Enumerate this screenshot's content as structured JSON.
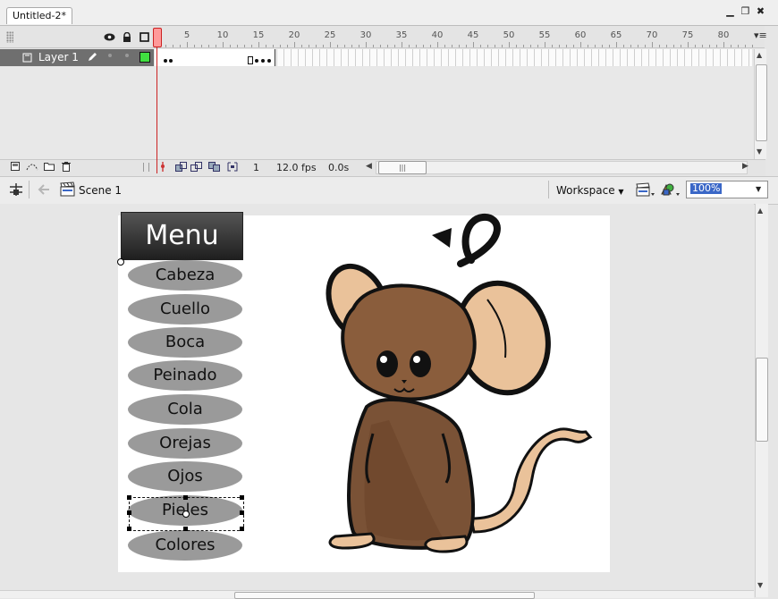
{
  "document": {
    "tab_title": "Untitled-2*"
  },
  "window_controls": {
    "minimize": "▁",
    "restore": "❐",
    "close": "✖"
  },
  "timeline": {
    "ruler_labels": [
      "5",
      "10",
      "15",
      "20",
      "25",
      "30",
      "35",
      "40",
      "45",
      "50",
      "55",
      "60",
      "65",
      "70",
      "75",
      "80"
    ],
    "layer_name": "Layer 1",
    "status": {
      "frame": "1",
      "fps": "12.0 fps",
      "time": "0.0s"
    }
  },
  "editbar": {
    "scene_label": "Scene 1",
    "workspace_label": "Workspace",
    "zoom_value": "100%"
  },
  "stage": {
    "menu_title": "Menu",
    "menu_items": [
      "Cabeza",
      "Cuello",
      "Boca",
      "Peinado",
      "Cola",
      "Orejas",
      "Ojos",
      "Pieles",
      "Colores"
    ],
    "selected_item": "Pieles"
  },
  "icons": [
    "eye-icon",
    "lock-icon",
    "outline-icon",
    "pencil-icon",
    "new-layer-icon",
    "add-guide-icon",
    "new-folder-icon",
    "delete-layer-icon",
    "center-frame-icon",
    "onion-skin-icon",
    "edit-multiple-frames-icon",
    "edit-bar-timeline-icon",
    "back-arrow-icon",
    "scene-icon",
    "edit-scene-icon",
    "edit-symbols-icon"
  ]
}
